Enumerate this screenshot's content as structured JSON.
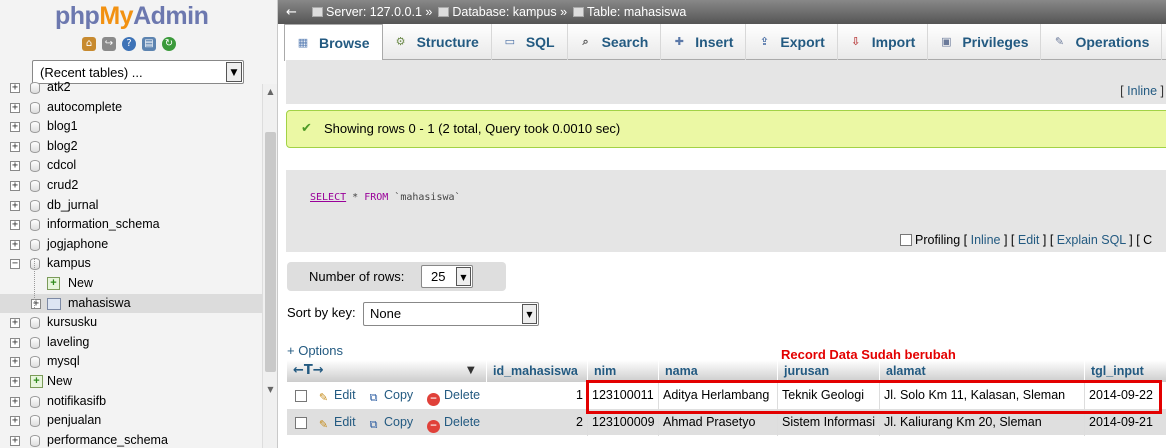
{
  "nav": {
    "logo": {
      "php": "php",
      "my": "My",
      "admin": "Admin"
    },
    "quick_icons": [
      "home-icon",
      "logout-icon",
      "help-icon",
      "docs-icon",
      "reload-icon"
    ],
    "recent_tables": "(Recent tables) ...",
    "databases": [
      {
        "label": "atk2"
      },
      {
        "label": "autocomplete"
      },
      {
        "label": "blog1"
      },
      {
        "label": "blog2"
      },
      {
        "label": "cdcol"
      },
      {
        "label": "crud2"
      },
      {
        "label": "db_jurnal"
      },
      {
        "label": "information_schema"
      },
      {
        "label": "jogjaphone"
      },
      {
        "label": "kampus",
        "expanded": true,
        "children": [
          {
            "label": "New",
            "type": "new"
          },
          {
            "label": "mahasiswa",
            "type": "table",
            "selected": true
          }
        ]
      },
      {
        "label": "kursusku"
      },
      {
        "label": "laveling"
      },
      {
        "label": "mysql"
      },
      {
        "label": "New",
        "type": "new"
      },
      {
        "label": "notifikasifb"
      },
      {
        "label": "penjualan"
      },
      {
        "label": "performance_schema"
      }
    ]
  },
  "breadcrumb": {
    "server": "Server: 127.0.0.1",
    "sep1": "»",
    "database": "Database: kampus",
    "sep2": "»",
    "table": "Table: mahasiswa"
  },
  "tabs": [
    {
      "label": "Browse",
      "icon": "browse-icon",
      "active": true
    },
    {
      "label": "Structure",
      "icon": "structure-icon"
    },
    {
      "label": "SQL",
      "icon": "sql-icon"
    },
    {
      "label": "Search",
      "icon": "search-icon"
    },
    {
      "label": "Insert",
      "icon": "insert-icon"
    },
    {
      "label": "Export",
      "icon": "export-icon"
    },
    {
      "label": "Import",
      "icon": "import-icon"
    },
    {
      "label": "Privileges",
      "icon": "privileges-icon"
    },
    {
      "label": "Operations",
      "icon": "operations-icon"
    }
  ],
  "inline_top": {
    "open": "[",
    "link": "Inline",
    "close": "]"
  },
  "message": "Showing rows 0 - 1 (2 total, Query took 0.0010 sec)",
  "sql": {
    "select": "SELECT",
    "star": " * ",
    "from": "FROM",
    "table": " `mahasiswa`"
  },
  "sql_bar": {
    "profiling": "Profiling",
    "links": [
      "Inline",
      "Edit",
      "Explain SQL"
    ],
    "trail": "[ C"
  },
  "num_rows": {
    "label": "Number of rows:",
    "value": "25"
  },
  "sort_key": {
    "label": "Sort by key:",
    "value": "None"
  },
  "options_link": "+ Options",
  "annotation": "Record Data Sudah berubah",
  "table": {
    "columns": [
      "id_mahasiswa",
      "nim",
      "nama",
      "jurusan",
      "alamat",
      "tgl_input"
    ],
    "row_actions": {
      "edit": "Edit",
      "copy": "Copy",
      "delete": "Delete"
    },
    "rows": [
      [
        "1",
        "123100011",
        "Aditya Herlambang",
        "Teknik Geologi",
        "Jl. Solo Km 11, Kalasan, Sleman",
        "2014-09-22"
      ],
      [
        "2",
        "123100009",
        "Ahmad Prasetyo",
        "Sistem Informasi",
        "Jl. Kaliurang Km 20, Sleman",
        "2014-09-21"
      ]
    ]
  },
  "colors": {
    "accent": "#235a81",
    "highlight": "#e30000",
    "success_bg": "#ebf8a4"
  }
}
